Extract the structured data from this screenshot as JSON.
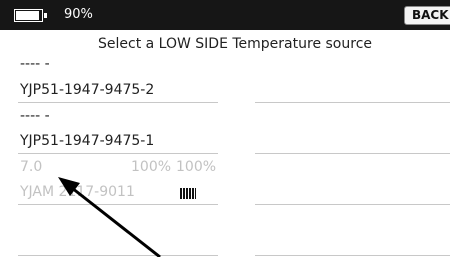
{
  "status_bar": {
    "battery_percent": "90%",
    "battery_level": 0.9,
    "back_label": "BACK"
  },
  "title": "Select a LOW SIDE Temperature source",
  "left_column": {
    "item1": {
      "placeholder": "---- -",
      "serial": "YJP51-1947-9475-2"
    },
    "item2": {
      "placeholder": "---- -",
      "serial": "YJP51-1947-9475-1"
    },
    "item3": {
      "value": "7.0",
      "percent_a": "100%",
      "percent_b": "100%",
      "serial": "YJAM  2117-9011"
    }
  },
  "icons": {
    "battery": "battery-icon",
    "signal": "signal-bars-icon",
    "arrow": "annotation-arrow"
  },
  "colors": {
    "status_bar_bg": "#161616",
    "divider": "#c8c8c8",
    "disabled_text": "#c2c2c2"
  }
}
